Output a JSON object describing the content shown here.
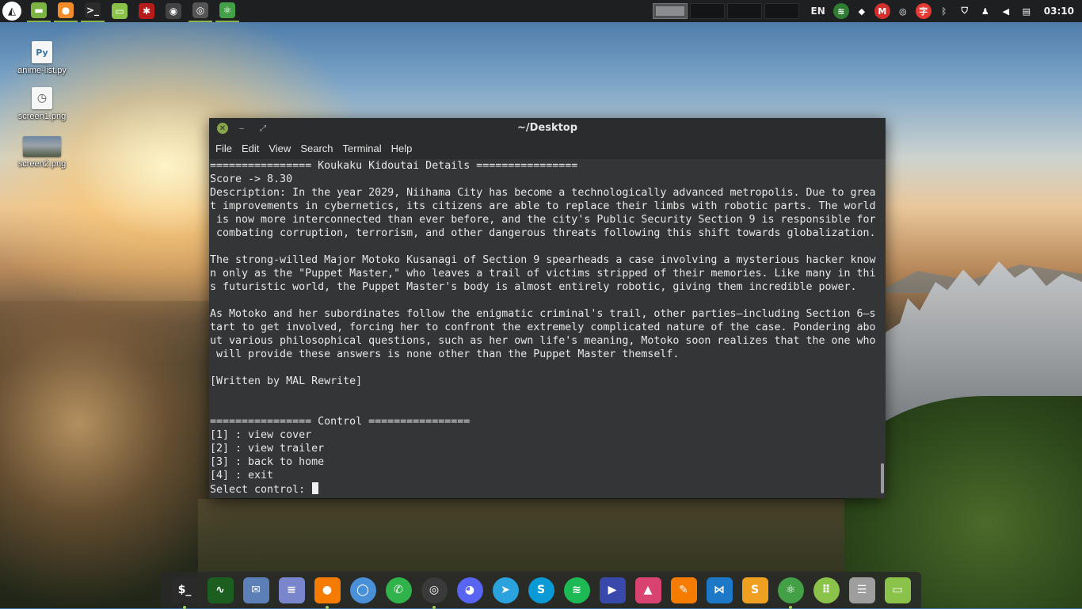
{
  "top_panel": {
    "workspace_count": 4,
    "active_workspace": 1,
    "language": "EN",
    "clock": "03:10",
    "apps": [
      {
        "name": "menu-icon",
        "color": "#ffffff",
        "glyph": "◭",
        "active": false
      },
      {
        "name": "files-icon",
        "color": "#7cb342",
        "glyph": "▬",
        "active": true
      },
      {
        "name": "firefox-icon",
        "color": "#f28c28",
        "glyph": "●",
        "active": true
      },
      {
        "name": "terminal-icon",
        "color": "#2b2b2b",
        "glyph": ">_",
        "active": true
      },
      {
        "name": "folder-icon",
        "color": "#8bc34a",
        "glyph": "▭",
        "active": false
      },
      {
        "name": "spider-icon",
        "color": "#b71c1c",
        "glyph": "✱",
        "active": false
      },
      {
        "name": "owl-icon",
        "color": "#444444",
        "glyph": "◉",
        "active": false
      },
      {
        "name": "obs-icon",
        "color": "#555555",
        "glyph": "◎",
        "active": true
      },
      {
        "name": "atom-icon",
        "color": "#43a047",
        "glyph": "⚛",
        "active": true
      }
    ],
    "tray": [
      {
        "name": "network-icon",
        "color": "#2e7d32",
        "glyph": "≋"
      },
      {
        "name": "dropbox-icon",
        "color": "#ffffff",
        "glyph": "◆"
      },
      {
        "name": "mega-icon",
        "color": "#d32f2f",
        "glyph": "M"
      },
      {
        "name": "obs-tray-icon",
        "color": "#ffffff",
        "glyph": "◎"
      },
      {
        "name": "translate-icon",
        "color": "#e53935",
        "glyph": "字"
      },
      {
        "name": "bluetooth-icon",
        "color": "#9e9e9e",
        "glyph": "ᛒ"
      },
      {
        "name": "shield-icon",
        "color": "#ffffff",
        "glyph": "⛉"
      },
      {
        "name": "notification-icon",
        "color": "#ffffff",
        "glyph": "♟"
      },
      {
        "name": "volume-icon",
        "color": "#ffffff",
        "glyph": "◀"
      },
      {
        "name": "clipboard-icon",
        "color": "#ffffff",
        "glyph": "▤"
      }
    ]
  },
  "desktop_icons": [
    {
      "label": "anime-list.py",
      "name": "python-file-icon",
      "glyph": "Py"
    },
    {
      "label": "screen1.png",
      "name": "image-file-icon",
      "glyph": "◷"
    },
    {
      "label": "screen2.png",
      "name": "image-thumbnail-icon",
      "glyph": ""
    }
  ],
  "terminal": {
    "title": "~/Desktop",
    "menu": [
      "File",
      "Edit",
      "View",
      "Search",
      "Terminal",
      "Help"
    ],
    "lines": [
      "================ Koukaku Kidoutai Details ================",
      "Score -> 8.30",
      "Description: In the year 2029, Niihama City has become a technologically advanced metropolis. Due to grea",
      "t improvements in cybernetics, its citizens are able to replace their limbs with robotic parts. The world",
      " is now more interconnected than ever before, and the city's Public Security Section 9 is responsible for",
      " combating corruption, terrorism, and other dangerous threats following this shift towards globalization.",
      "",
      "The strong-willed Major Motoko Kusanagi of Section 9 spearheads a case involving a mysterious hacker know",
      "n only as the \"Puppet Master,\" who leaves a trail of victims stripped of their memories. Like many in thi",
      "s futuristic world, the Puppet Master's body is almost entirely robotic, giving them incredible power.",
      "",
      "As Motoko and her subordinates follow the enigmatic criminal's trail, other parties—including Section 6—s",
      "tart to get involved, forcing her to confront the extremely complicated nature of the case. Pondering abo",
      "ut various philosophical questions, such as her own life's meaning, Motoko soon realizes that the one who",
      " will provide these answers is none other than the Puppet Master themself.",
      "",
      "[Written by MAL Rewrite]",
      "",
      "",
      "================ Control ================",
      "[1] : view cover",
      "[2] : view trailer",
      "[3] : back to home",
      "[4] : exit"
    ],
    "prompt": "Select control: "
  },
  "dock": [
    {
      "name": "terminal-dock-icon",
      "color": "#2a2a2a",
      "glyph": "$_",
      "running": true
    },
    {
      "name": "system-monitor-icon",
      "color": "#1b5e20",
      "glyph": "∿",
      "running": false
    },
    {
      "name": "mail-icon",
      "color": "#5c7fb8",
      "glyph": "✉",
      "running": false
    },
    {
      "name": "text-editor-icon",
      "color": "#7986cb",
      "glyph": "≡",
      "running": false
    },
    {
      "name": "firefox-dock-icon",
      "color": "#f57c00",
      "glyph": "●",
      "running": true
    },
    {
      "name": "chromium-icon",
      "color": "#4a90d9",
      "glyph": "◯",
      "running": false
    },
    {
      "name": "whatsapp-icon",
      "color": "#2fb34a",
      "glyph": "✆",
      "running": false
    },
    {
      "name": "obs-dock-icon",
      "color": "#3a3a3a",
      "glyph": "◎",
      "running": true
    },
    {
      "name": "discord-icon",
      "color": "#5865f2",
      "glyph": "◕",
      "running": false
    },
    {
      "name": "telegram-icon",
      "color": "#2aa2dd",
      "glyph": "➤",
      "running": false
    },
    {
      "name": "skype-icon",
      "color": "#0a9ad6",
      "glyph": "S",
      "running": false
    },
    {
      "name": "spotify-icon",
      "color": "#1db954",
      "glyph": "≋",
      "running": false
    },
    {
      "name": "media-player-icon",
      "color": "#3949ab",
      "glyph": "▶",
      "running": false
    },
    {
      "name": "image-viewer-icon",
      "color": "#d84371",
      "glyph": "▲",
      "running": false
    },
    {
      "name": "drawing-icon",
      "color": "#f57c00",
      "glyph": "✎",
      "running": false
    },
    {
      "name": "vscode-icon",
      "color": "#1e78c8",
      "glyph": "⋈",
      "running": false
    },
    {
      "name": "sublime-icon",
      "color": "#f0a020",
      "glyph": "S",
      "running": false
    },
    {
      "name": "atom-dock-icon",
      "color": "#43a047",
      "glyph": "⚛",
      "running": true
    },
    {
      "name": "app-grid-icon",
      "color": "#8bc34a",
      "glyph": "⠿",
      "running": false
    },
    {
      "name": "settings-icon",
      "color": "#9e9e9e",
      "glyph": "☰",
      "running": false
    },
    {
      "name": "files-dock-icon",
      "color": "#8bc34a",
      "glyph": "▭",
      "running": false
    }
  ]
}
